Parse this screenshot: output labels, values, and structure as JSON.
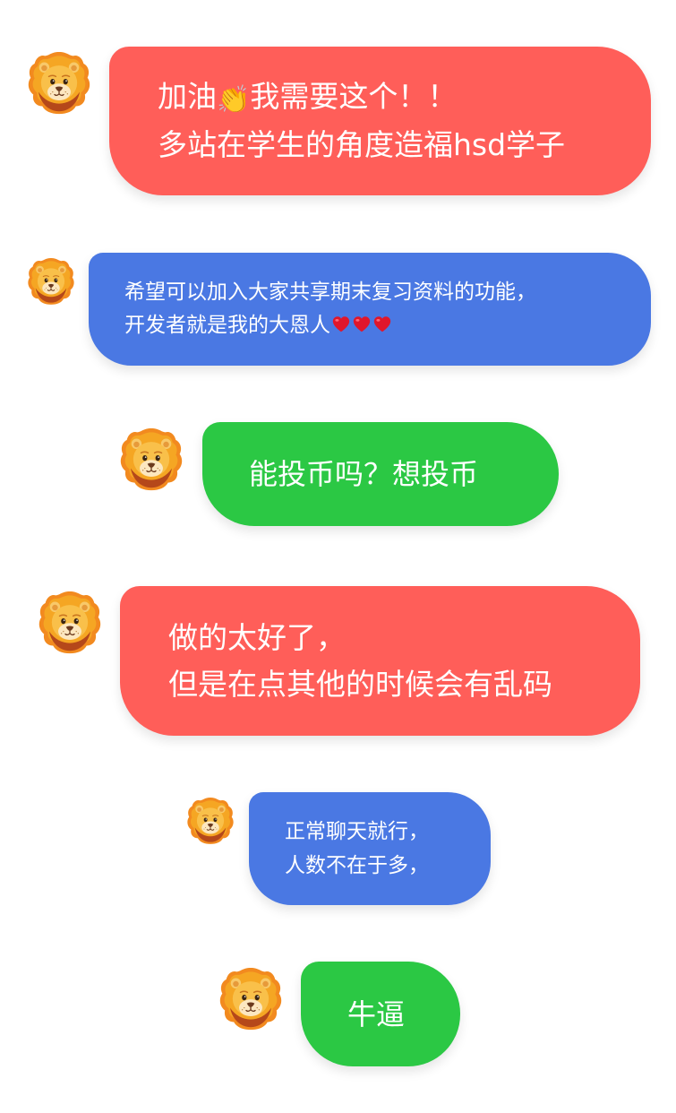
{
  "colors": {
    "red": "#FF5E59",
    "blue": "#4A78E3",
    "green": "#2BC844",
    "text": "#FFFFFF"
  },
  "avatar_icon": "lion-face-icon",
  "messages": [
    {
      "color": "red",
      "lines": [
        "加油",
        "我需要这个！！",
        "多站在学生的角度造福hsd学子"
      ],
      "emoji": "clapping-hands-icon"
    },
    {
      "color": "blue",
      "lines": [
        "希望可以加入大家共享期末复习资料的功能，",
        "开发者就是我的大恩人"
      ],
      "emoji": "red-heart-icon",
      "emoji_count": 3
    },
    {
      "color": "green",
      "lines": [
        "能投币吗？想投币"
      ]
    },
    {
      "color": "red",
      "lines": [
        "做的太好了，",
        "但是在点其他的时候会有乱码"
      ]
    },
    {
      "color": "blue",
      "lines": [
        "正常聊天就行，",
        "人数不在于多，"
      ]
    },
    {
      "color": "green",
      "lines": [
        "牛逼"
      ]
    }
  ]
}
